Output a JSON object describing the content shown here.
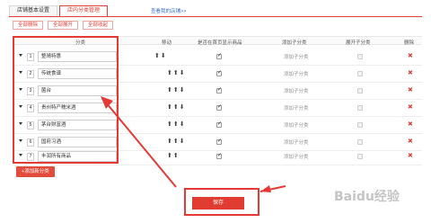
{
  "tabs": [
    {
      "label": "店铺基本设置",
      "active": false
    },
    {
      "label": "店内分类管理",
      "active": true
    }
  ],
  "store_link": "查看我的店铺>>",
  "actions": [
    "全部删除",
    "全部展开",
    "全部收起"
  ],
  "columns": {
    "category": "分类",
    "move": "移动",
    "show_home": "是否在首页显示商品",
    "add_sub": "添加子分类",
    "expand_sub": "展开子分类",
    "delete": "删除"
  },
  "rows": [
    {
      "order": "1",
      "name": "整晴特惠",
      "move": "⬆⬇",
      "show_home": true,
      "add_sub": "添加子分类"
    },
    {
      "order": "2",
      "name": "传统食谱",
      "move": "⬆⬆⬇",
      "show_home": true,
      "add_sub": "添加子分类"
    },
    {
      "order": "3",
      "name": "菌台",
      "move": "⬆⬆⬇",
      "show_home": true,
      "add_sub": "添加子分类"
    },
    {
      "order": "4",
      "name": "贵州特产糯米酒",
      "move": "⬆⬆⬇",
      "show_home": true,
      "add_sub": "添加子分类"
    },
    {
      "order": "5",
      "name": "茅台财富酒",
      "move": "⬆⬆⬇",
      "show_home": true,
      "add_sub": "添加子分类"
    },
    {
      "order": "6",
      "name": "国府习酒",
      "move": "⬆⬆⬇",
      "show_home": true,
      "add_sub": "添加子分类"
    },
    {
      "order": "7",
      "name": "丰润所有商品",
      "move": "⬆⬆",
      "show_home": true,
      "add_sub": "添加子分类"
    }
  ],
  "add_category_label": "+添加新分类",
  "save_label": "保存",
  "watermark_text": "Baidu经验",
  "colors": {
    "accent": "#e0403a",
    "annotation": "#e53935"
  }
}
